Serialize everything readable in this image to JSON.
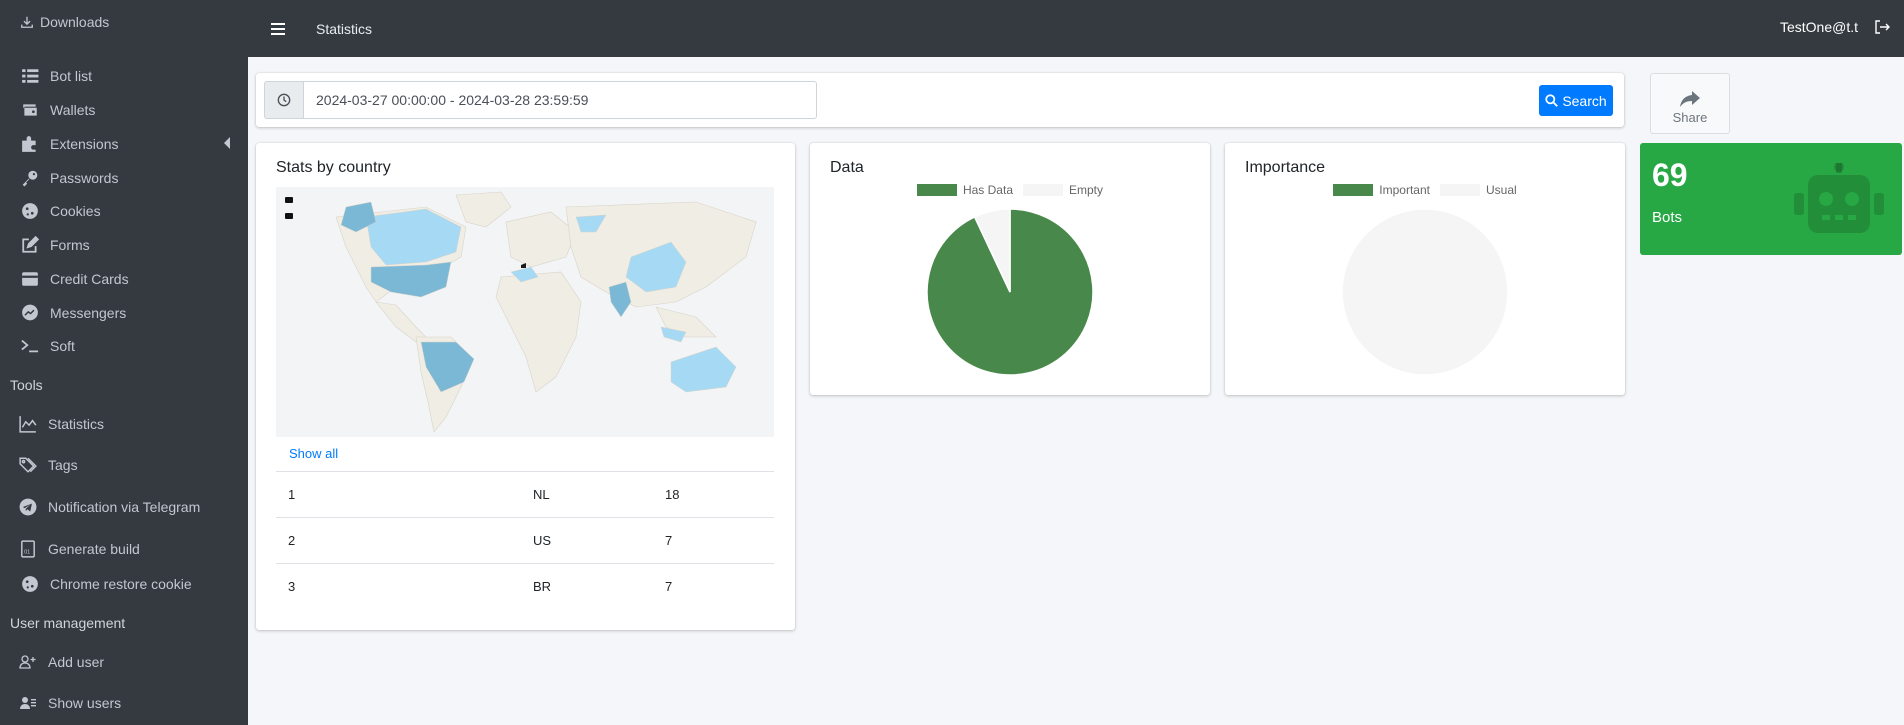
{
  "sidebar": {
    "top_item": "Downloads",
    "items": [
      {
        "label": "Bot list",
        "icon": "list-icon"
      },
      {
        "label": "Wallets",
        "icon": "wallet-icon"
      },
      {
        "label": "Extensions",
        "icon": "puzzle-icon"
      },
      {
        "label": "Passwords",
        "icon": "key-icon"
      },
      {
        "label": "Cookies",
        "icon": "cookie-icon"
      },
      {
        "label": "Forms",
        "icon": "edit-icon"
      },
      {
        "label": "Credit Cards",
        "icon": "credit-card-icon"
      },
      {
        "label": "Messengers",
        "icon": "messenger-icon"
      },
      {
        "label": "Soft",
        "icon": "terminal-icon"
      }
    ],
    "tools_header": "Tools",
    "tools": [
      {
        "label": "Statistics",
        "icon": "chart-line-icon"
      },
      {
        "label": "Tags",
        "icon": "tags-icon"
      },
      {
        "label": "Notification via Telegram",
        "icon": "telegram-icon"
      },
      {
        "label": "Generate build",
        "icon": "file-binary-icon"
      },
      {
        "label": "Chrome restore cookie",
        "icon": "cookie-icon"
      }
    ],
    "user_mgmt_header": "User management",
    "user_mgmt": [
      {
        "label": "Add user",
        "icon": "user-plus-icon"
      },
      {
        "label": "Show users",
        "icon": "users-list-icon"
      }
    ]
  },
  "topbar": {
    "title": "Statistics",
    "user": "TestOne@t.t"
  },
  "filter": {
    "date_range": "2024-03-27 00:00:00 - 2024-03-28 23:59:59",
    "search_label": "Search"
  },
  "share": {
    "label": "Share"
  },
  "country_card": {
    "title": "Stats by country",
    "show_all": "Show all",
    "rows": [
      {
        "rank": "1",
        "code": "NL",
        "count": "18"
      },
      {
        "rank": "2",
        "code": "US",
        "count": "7"
      },
      {
        "rank": "3",
        "code": "BR",
        "count": "7"
      }
    ]
  },
  "data_card": {
    "title": "Data"
  },
  "importance_card": {
    "title": "Importance"
  },
  "bots_card": {
    "count": "69",
    "label": "Bots",
    "color": "#28a745"
  },
  "chart_data": [
    {
      "type": "pie",
      "title": "Data",
      "categories": [
        "Has Data",
        "Empty"
      ],
      "values": [
        93,
        7
      ],
      "colors": [
        "#48894b",
        "#f5f5f5"
      ],
      "legend": "top"
    },
    {
      "type": "pie",
      "title": "Importance",
      "categories": [
        "Important",
        "Usual"
      ],
      "values": [
        0,
        100
      ],
      "colors": [
        "#48894b",
        "#f5f5f5"
      ],
      "legend": "top"
    }
  ]
}
